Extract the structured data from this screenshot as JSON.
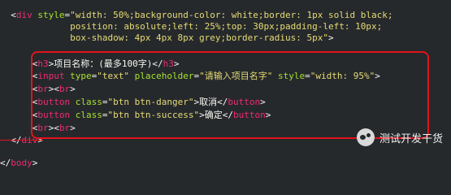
{
  "code": {
    "lines": [
      [
        {
          "c": "pun",
          "t": "  <"
        },
        {
          "c": "tag",
          "t": "div"
        },
        {
          "c": "attr",
          "t": " style"
        },
        {
          "c": "pun",
          "t": "="
        },
        {
          "c": "str",
          "t": "\"width: 50%;background-color: white;border: 1px solid black;"
        }
      ],
      [
        {
          "c": "str",
          "t": "             position: absolute;left: 25%;top: 30px;padding-left: 10px;"
        }
      ],
      [
        {
          "c": "str",
          "t": "             box-shadow: 4px 4px 8px grey;border-radius: 5px\""
        },
        {
          "c": "pun",
          "t": ">"
        }
      ],
      [
        {
          "c": "txt",
          "t": ""
        }
      ],
      [
        {
          "c": "pun",
          "t": "      <"
        },
        {
          "c": "tag",
          "t": "h3"
        },
        {
          "c": "pun",
          "t": ">"
        },
        {
          "c": "txt",
          "t": "项目名称：(最多100字)"
        },
        {
          "c": "pun",
          "t": "</"
        },
        {
          "c": "tag",
          "t": "h3"
        },
        {
          "c": "pun",
          "t": ">"
        }
      ],
      [
        {
          "c": "pun",
          "t": "      <"
        },
        {
          "c": "tag",
          "t": "input"
        },
        {
          "c": "attr",
          "t": " type"
        },
        {
          "c": "pun",
          "t": "="
        },
        {
          "c": "str",
          "t": "\"text\""
        },
        {
          "c": "attr",
          "t": " placeholder"
        },
        {
          "c": "pun",
          "t": "="
        },
        {
          "c": "str",
          "t": "\"请输入项目名字\""
        },
        {
          "c": "attr",
          "t": " style"
        },
        {
          "c": "pun",
          "t": "="
        },
        {
          "c": "str",
          "t": "\"width: 95%\""
        },
        {
          "c": "pun",
          "t": ">"
        }
      ],
      [
        {
          "c": "pun",
          "t": "      <"
        },
        {
          "c": "tag",
          "t": "br"
        },
        {
          "c": "pun",
          "t": "><"
        },
        {
          "c": "tag",
          "t": "br"
        },
        {
          "c": "pun",
          "t": ">"
        }
      ],
      [
        {
          "c": "pun",
          "t": "      <"
        },
        {
          "c": "tag",
          "t": "button"
        },
        {
          "c": "attr",
          "t": " class"
        },
        {
          "c": "pun",
          "t": "="
        },
        {
          "c": "str",
          "t": "\"btn btn-danger\""
        },
        {
          "c": "pun",
          "t": ">"
        },
        {
          "c": "txt",
          "t": "取消"
        },
        {
          "c": "pun",
          "t": "</"
        },
        {
          "c": "tag",
          "t": "button"
        },
        {
          "c": "pun",
          "t": ">"
        }
      ],
      [
        {
          "c": "pun",
          "t": "      <"
        },
        {
          "c": "tag",
          "t": "button"
        },
        {
          "c": "attr",
          "t": " class"
        },
        {
          "c": "pun",
          "t": "="
        },
        {
          "c": "str",
          "t": "\"btn btn-success\""
        },
        {
          "c": "pun",
          "t": ">"
        },
        {
          "c": "txt",
          "t": "确定"
        },
        {
          "c": "pun",
          "t": "</"
        },
        {
          "c": "tag",
          "t": "button"
        },
        {
          "c": "pun",
          "t": ">"
        }
      ],
      [
        {
          "c": "pun",
          "t": "      <"
        },
        {
          "c": "tag",
          "t": "br"
        },
        {
          "c": "pun",
          "t": "><"
        },
        {
          "c": "tag",
          "t": "br"
        },
        {
          "c": "pun",
          "t": ">"
        }
      ],
      [
        {
          "c": "pun",
          "t": "  </"
        },
        {
          "c": "tag",
          "t": "div"
        },
        {
          "c": "pun",
          "t": ">"
        }
      ],
      [
        {
          "c": "txt",
          "t": ""
        }
      ],
      [
        {
          "c": "pun",
          "t": "</"
        },
        {
          "c": "tag",
          "t": "body"
        },
        {
          "c": "pun",
          "t": ">"
        }
      ]
    ]
  },
  "watermark": {
    "icon": "wechat-icon",
    "text": "测试开发干货"
  },
  "colors": {
    "background": "#26292c",
    "tag": "#f02a71",
    "attribute": "#a6e22e",
    "string": "#e6db74",
    "highlight_border": "#e0141b"
  }
}
